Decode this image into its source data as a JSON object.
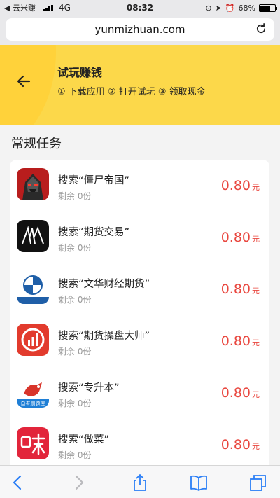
{
  "status": {
    "back_app": "云米赚",
    "carrier": "4G",
    "time": "08:32",
    "battery": "68%",
    "battery_level": 0.68
  },
  "browser": {
    "url": "yunmizhuan.com"
  },
  "header": {
    "title": "试玩赚钱",
    "steps": "① 下载应用 ② 打开试玩 ③ 领取现金"
  },
  "section": {
    "title": "常规任务"
  },
  "tasks": [
    {
      "name": "搜索“僵尸帝国”",
      "remain": "剩余 0份",
      "price": "0.80",
      "unit": "元",
      "icon": "zombie-empire-icon"
    },
    {
      "name": "搜索“期货交易”",
      "remain": "剩余 0份",
      "price": "0.80",
      "unit": "元",
      "icon": "futures-trading-icon"
    },
    {
      "name": "搜索“文华财经期货”",
      "remain": "剩余 0份",
      "price": "0.80",
      "unit": "元",
      "icon": "wenhua-finance-icon"
    },
    {
      "name": "搜索“期货操盘大师”",
      "remain": "剩余 0份",
      "price": "0.80",
      "unit": "元",
      "icon": "futures-master-icon"
    },
    {
      "name": "搜索“专升本”",
      "remain": "剩余 0份",
      "price": "0.80",
      "unit": "元",
      "icon": "exam-bank-icon",
      "icon_text": "自考刷题库"
    },
    {
      "name": "搜索“做菜”",
      "remain": "剩余 0份",
      "price": "0.80",
      "unit": "元",
      "icon": "cooking-icon"
    }
  ],
  "colors": {
    "banner": "#fcd84a",
    "price": "#e9473f",
    "toolbar_icon": "#2a7ef6"
  }
}
